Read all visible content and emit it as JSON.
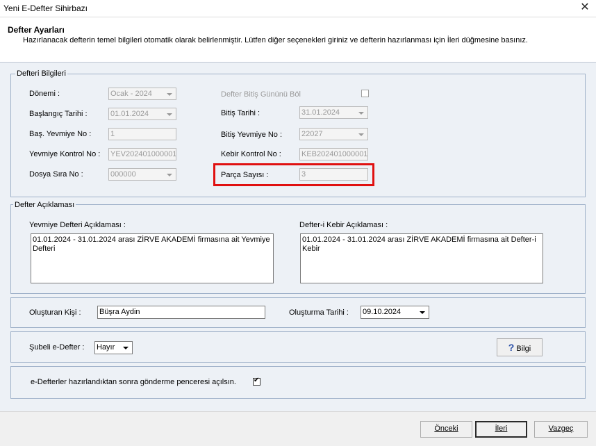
{
  "window": {
    "title": "Yeni E-Defter Sihirbazı"
  },
  "header": {
    "title": "Defter Ayarları",
    "description": "Hazırlanacak defterin temel bilgileri otomatik olarak belirlenmiştir. Lütfen diğer seçenekleri giriniz ve defterin hazırlanması için İleri düğmesine basınız."
  },
  "defter_bilgileri": {
    "legend": "Defteri Bilgileri",
    "donemi_label": "Dönemi :",
    "donemi_value": "Ocak - 2024",
    "baslangic_label": "Başlangıç Tarihi :",
    "baslangic_value": "01.01.2024",
    "bas_yevmiye_label": "Baş. Yevmiye No :",
    "bas_yevmiye_value": "1",
    "yevmiye_kontrol_label": "Yevmiye Kontrol No :",
    "yevmiye_kontrol_value": "YEV202401000001",
    "dosya_sira_label": "Dosya Sıra No :",
    "dosya_sira_value": "000000",
    "bitis_bol_label": "Defter Bitiş Gününü Böl",
    "bitis_tarihi_label": "Bitiş Tarihi :",
    "bitis_tarihi_value": "31.01.2024",
    "bitis_yevmiye_label": "Bitiş Yevmiye No :",
    "bitis_yevmiye_value": "22027",
    "kebir_kontrol_label": "Kebir Kontrol No :",
    "kebir_kontrol_value": "KEB202401000001",
    "parca_label": "Parça Sayısı :",
    "parca_value": "3"
  },
  "defter_aciklamasi": {
    "legend": "Defter Açıklaması",
    "yevmiye_label": "Yevmiye Defteri Açıklaması :",
    "yevmiye_text": "01.01.2024 - 31.01.2024 arası ZİRVE AKADEMİ firmasına ait Yevmiye Defteri",
    "kebir_label": "Defter-i Kebir Açıklaması :",
    "kebir_text": "01.01.2024 - 31.01.2024 arası ZİRVE AKADEMİ firmasına ait Defter-i Kebir"
  },
  "olusturan": {
    "kisi_label": "Oluşturan Kişi :",
    "kisi_value": "Büşra Aydin",
    "tarih_label": "Oluşturma Tarihi :",
    "tarih_value": "09.10.2024"
  },
  "subeli": {
    "label": "Şubeli e-Defter :",
    "value": "Hayır",
    "bilgi_label": "Bilgi",
    "bilgi_icon": "?"
  },
  "gonderme": {
    "label": "e-Defterler hazırlandıktan sonra gönderme penceresi açılsın.",
    "checked": true
  },
  "footer": {
    "onceki": "Önceki",
    "ileri": "İleri",
    "vazgec": "Vazgeç"
  }
}
